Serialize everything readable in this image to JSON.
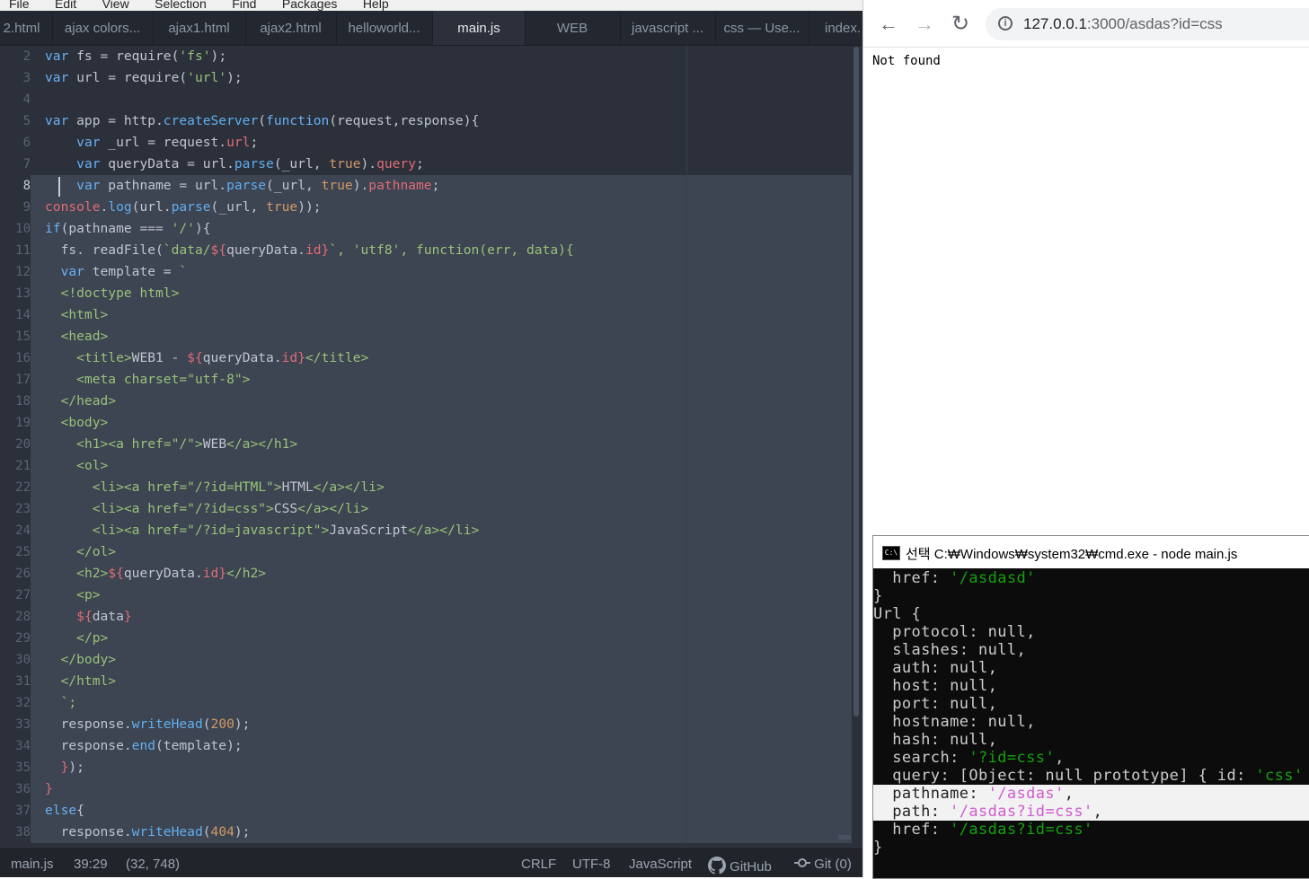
{
  "editor": {
    "menu": [
      "File",
      "Edit",
      "View",
      "Selection",
      "Find",
      "Packages",
      "Help"
    ],
    "tabs": [
      "2.html",
      "ajax colors...",
      "ajax1.html",
      "ajax2.html",
      "helloworld...",
      "main.js",
      "WEB",
      "javascript ...",
      "css — Use...",
      "index."
    ],
    "active_tab": "main.js",
    "line_numbers": [
      "2",
      "3",
      "4",
      "5",
      "6",
      "7",
      "8",
      "9",
      "10",
      "11",
      "12",
      "13",
      "14",
      "15",
      "16",
      "17",
      "18",
      "19",
      "20",
      "21",
      "22",
      "23",
      "24",
      "25",
      "26",
      "27",
      "28",
      "29",
      "30",
      "31",
      "32",
      "33",
      "34",
      "35",
      "36",
      "37",
      "38"
    ],
    "code_lines": [
      "var fs = require('fs');",
      "var url = require('url');",
      "",
      "var app = http.createServer(function(request,response){",
      "    var _url = request.url;",
      "    var queryData = url.parse(_url, true).query;",
      "    var pathname = url.parse(_url, true).pathname;",
      "console.log(url.parse(_url, true));",
      "if(pathname === '/'){",
      "  fs. readFile(`data/${queryData.id}`, 'utf8', function(err, data){",
      "  var template = `",
      "  <!doctype html>",
      "  <html>",
      "  <head>",
      "    <title>WEB1 - ${queryData.id}</title>",
      "    <meta charset=\"utf-8\">",
      "  </head>",
      "  <body>",
      "    <h1><a href=\"/\">WEB</a></h1>",
      "    <ol>",
      "      <li><a href=\"/?id=HTML\">HTML</a></li>",
      "      <li><a href=\"/?id=css\">CSS</a></li>",
      "      <li><a href=\"/?id=javascript\">JavaScript</a></li>",
      "    </ol>",
      "    <h2>${queryData.id}</h2>",
      "    <p>",
      "    ${data}",
      "    </p>",
      "  </body>",
      "  </html>",
      "  `;",
      "  response.writeHead(200);",
      "  response.end(template);",
      "  });",
      "}",
      "else{",
      "  response.writeHead(404);"
    ],
    "status": {
      "file": "main.js",
      "cursor": "39:29",
      "selection": "(32, 748)",
      "line_ending": "CRLF",
      "encoding": "UTF-8",
      "grammar": "JavaScript",
      "github": "GitHub",
      "git": "Git (0)"
    }
  },
  "browser": {
    "back_icon": "←",
    "forward_icon": "→",
    "reload_icon": "↻",
    "info_icon": "i",
    "url_host": "127.0.0.1",
    "url_path": ":3000/asdas?id=css",
    "page_text": "Not found"
  },
  "console": {
    "title": "선택 C:₩Windows₩system32₩cmd.exe - node  main.js",
    "icon_text": "C:\\",
    "lines": [
      "  href: '/asdasd'",
      "}",
      "Url {",
      "  protocol: null,",
      "  slashes: null,",
      "  auth: null,",
      "  host: null,",
      "  port: null,",
      "  hostname: null,",
      "  hash: null,",
      "  search: '?id=css',",
      "  query: [Object: null prototype] { id: 'css' },",
      "  pathname: '/asdas',",
      "  path: '/asdas?id=css',",
      "  href: '/asdas?id=css'",
      "}"
    ]
  },
  "colors": {
    "editor_bg": "#2b303b",
    "selection_bg": "#3d4452",
    "console_bg": "#0c0c0c",
    "console_string": "#13a10e"
  }
}
